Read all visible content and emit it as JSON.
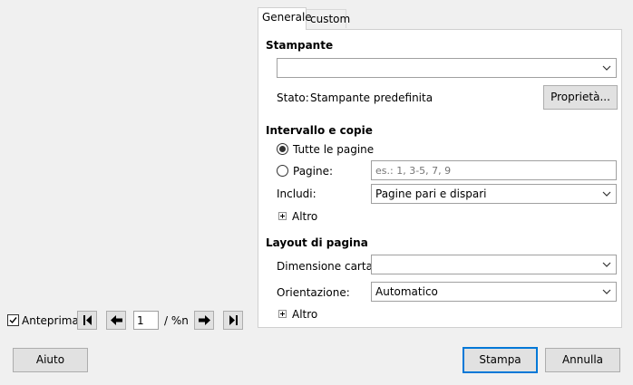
{
  "tabs": [
    {
      "label": "Generale",
      "active": true
    },
    {
      "label": "custom",
      "active": false
    }
  ],
  "printer": {
    "section_title": "Stampante",
    "printer_select_value": "",
    "status_label": "Stato:",
    "status_value": "Stampante predefinita",
    "properties_button": "Proprietà..."
  },
  "range": {
    "section_title": "Intervallo e copie",
    "all_pages_label": "Tutte le pagine",
    "all_pages_selected": true,
    "pages_label": "Pagine:",
    "pages_value": "",
    "pages_placeholder": "es.: 1, 3-5, 7, 9",
    "include_label": "Includi:",
    "include_value": "Pagine pari e dispari",
    "more_label": "Altro"
  },
  "layout": {
    "section_title": "Layout di pagina",
    "paper_size_label": "Dimensione carta:",
    "paper_size_value": "",
    "orientation_label": "Orientazione:",
    "orientation_value": "Automatico",
    "more_label": "Altro"
  },
  "preview": {
    "checkbox_label": "Anteprima",
    "checked": true,
    "page_value": "1",
    "page_total": "/ %n"
  },
  "footer": {
    "help_button": "Aiuto",
    "print_button": "Stampa",
    "cancel_button": "Annulla"
  },
  "colors": {
    "default_button_border": "#0078d7",
    "dialog_bg": "#f0f0f0",
    "panel_bg": "#ffffff"
  }
}
